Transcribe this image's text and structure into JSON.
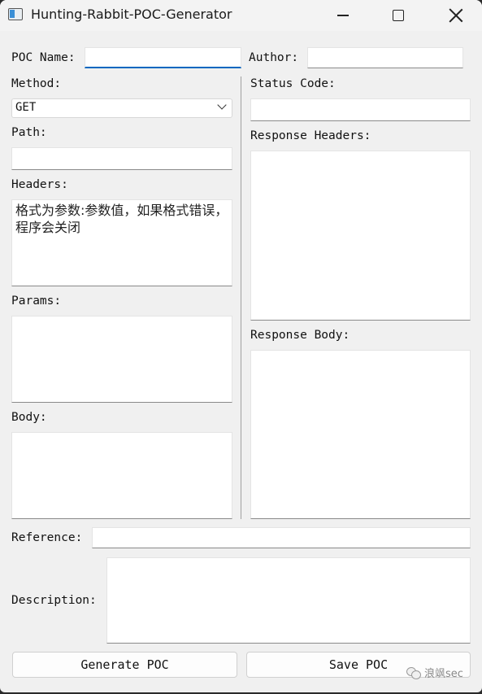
{
  "window": {
    "title": "Hunting-Rabbit-POC-Generator"
  },
  "labels": {
    "poc_name": "POC Name:",
    "author": "Author:",
    "method": "Method:",
    "path": "Path:",
    "headers": "Headers:",
    "params": "Params:",
    "body": "Body:",
    "status_code": "Status Code:",
    "response_headers": "Response Headers:",
    "response_body": "Response Body:",
    "reference": "Reference:",
    "description": "Description:"
  },
  "fields": {
    "poc_name": "",
    "author": "",
    "method": "GET",
    "path": "",
    "headers": "格式为参数:参数值，如果格式错误，程序会关闭",
    "params": "",
    "body": "",
    "status_code": "",
    "response_headers": "",
    "response_body": "",
    "reference": "",
    "description": ""
  },
  "buttons": {
    "generate": "Generate POC",
    "save": "Save POC"
  },
  "watermark": "浪飒sec"
}
